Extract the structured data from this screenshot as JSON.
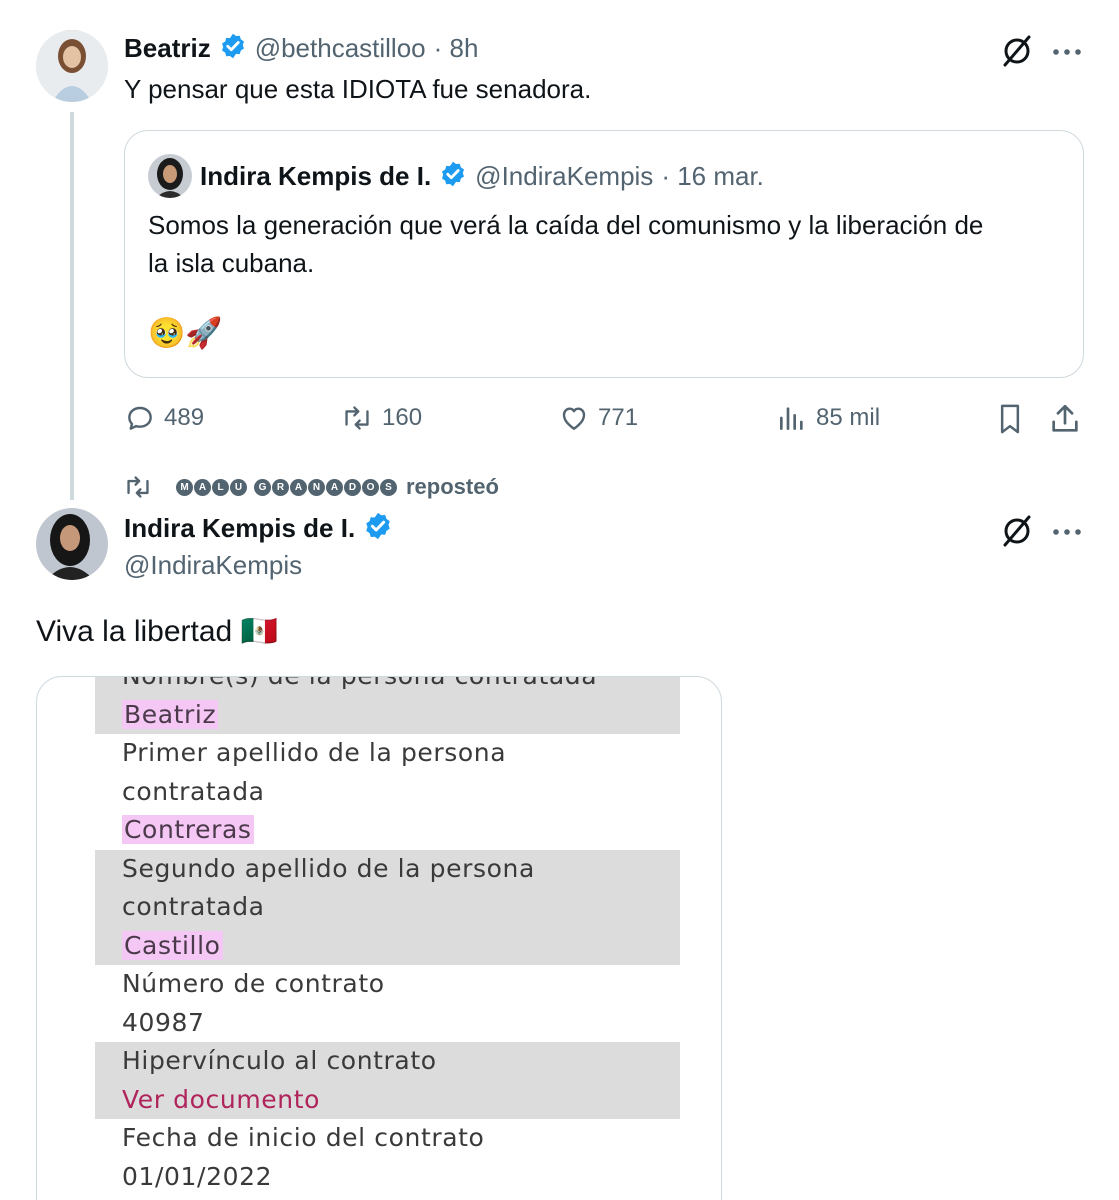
{
  "tweet1": {
    "name": "Beatriz",
    "handle": "@bethcastilloo",
    "time": "· 8h",
    "text": "Y pensar que esta IDIOTA fue senadora."
  },
  "quote": {
    "name": "Indira Kempis de I.",
    "handle": "@IndiraKempis",
    "time": "· 16 mar.",
    "text_line1": "Somos la generación que verá la caída del comunismo y la liberación de",
    "text_line2": "la isla  cubana.",
    "emojis": "🥹🚀"
  },
  "actions": {
    "replies": "489",
    "reposts": "160",
    "likes": "771",
    "views": "85 mil"
  },
  "repost_bar": {
    "letters": [
      "M",
      "A",
      "L",
      "U",
      " ",
      "G",
      "R",
      "A",
      "N",
      "A",
      "D",
      "O",
      "S"
    ],
    "label": "reposteó"
  },
  "tweet2": {
    "name": "Indira Kempis de I.",
    "handle": "@IndiraKempis",
    "text": "Viva la libertad",
    "flag": "🇲🇽"
  },
  "document": {
    "rows": [
      {
        "label": "Nombre(s) de la persona contratada",
        "value": "Beatriz"
      },
      {
        "label_1": "Primer apellido de la persona",
        "label_2": "contratada",
        "value": "Contreras"
      },
      {
        "label_1": "Segundo apellido de la persona",
        "label_2": "contratada",
        "value": "Castillo"
      },
      {
        "label": "Número de contrato",
        "value": "40987"
      },
      {
        "label": "Hipervínculo al contrato",
        "value": "Ver documento"
      },
      {
        "label": "Fecha de inicio del contrato",
        "value": "01/01/2022"
      }
    ]
  },
  "colors": {
    "accent_blue": "#1d9bf0",
    "muted_text": "#536471",
    "border": "#cfd9de",
    "highlight": "#f4c7f4",
    "link": "#b0245c"
  }
}
